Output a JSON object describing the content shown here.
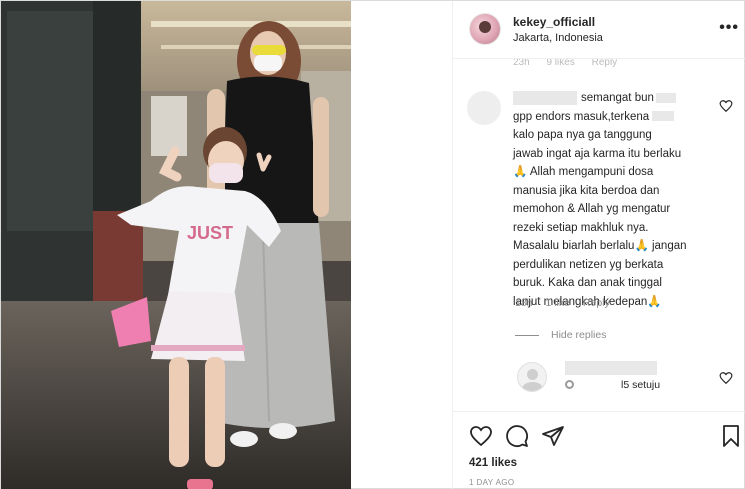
{
  "header": {
    "username": "kekey_officiall",
    "location": "Jakarta, Indonesia",
    "more_icon": "ellipsis-icon"
  },
  "comments": {
    "cut_meta": {
      "time": "23h",
      "likes": "9 likes",
      "reply": "Reply"
    },
    "main_comment": {
      "lines": [
        "semangat bun",
        "gpp endors masuk,terkena",
        "kalo papa nya ga tanggung",
        "jawab ingat aja karma itu berlaku",
        "🙏 Allah mengampuni dosa",
        "manusia jika kita berdoa dan",
        "memohon & Allah yg mengatur",
        "rezeki setiap makhluk nya.",
        "Masalalu biarlah berlalu🙏 jangan",
        "perdulikan netizen yg berkata",
        "buruk. Kaka dan anak tinggal",
        "lanjut melangkah kedepan🙏"
      ],
      "time": "18h",
      "likes": "1 like",
      "reply": "Reply"
    },
    "hide_replies": "Hide replies",
    "reply_comment": {
      "text": "l5 setuju"
    }
  },
  "actions": {
    "likes": "421 likes",
    "post_time": "1 DAY AGO"
  },
  "colors": {
    "text": "#262626",
    "muted": "#8e8e8e",
    "border": "#efefef"
  }
}
